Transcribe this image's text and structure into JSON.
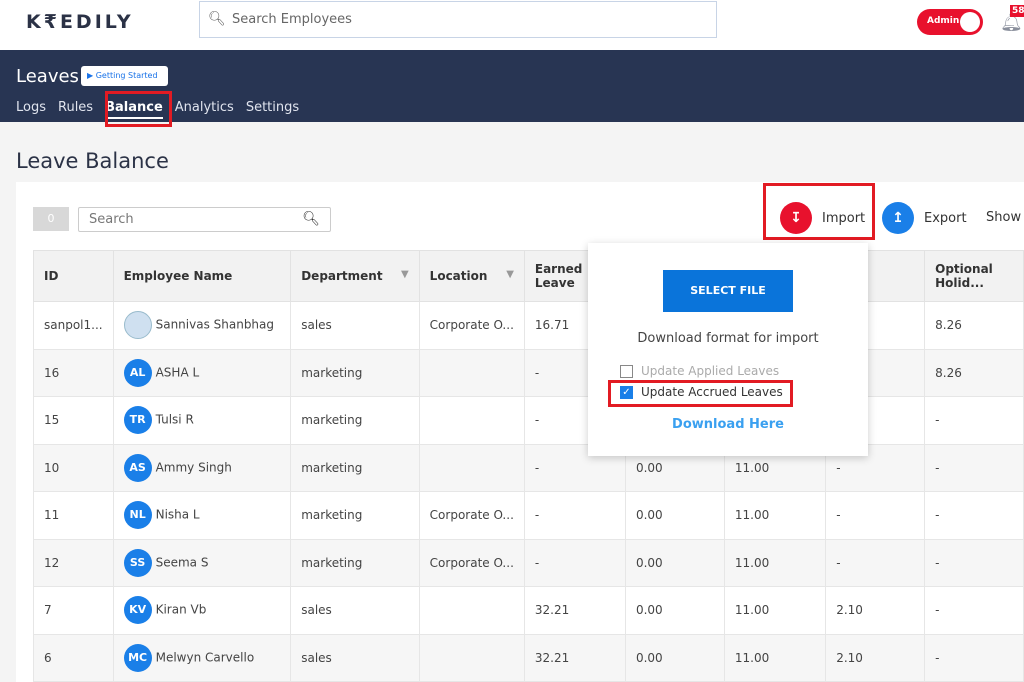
{
  "header": {
    "logo": "K₹EDILY",
    "search_placeholder": "Search Employees",
    "admin_label": "Admin",
    "notification_count": "58"
  },
  "module": {
    "title": "Leaves",
    "getting_started": "Getting Started",
    "tabs": [
      "Logs",
      "Rules",
      "Balance",
      "Analytics",
      "Settings"
    ],
    "active_tab": "Balance"
  },
  "page": {
    "title": "Leave Balance",
    "selected_count": "0",
    "search_placeholder": "Search",
    "import_label": "Import",
    "export_label": "Export",
    "show_label": "Show"
  },
  "table": {
    "headers": [
      "ID",
      "Employee Name",
      "Department",
      "Location",
      "Earned Leave",
      "",
      "",
      "",
      "Optional Holid..."
    ],
    "rows": [
      {
        "id": "sanpol1...",
        "name": "Sannivas Shanbhag",
        "initials": "",
        "department": "sales",
        "location": "Corporate O...",
        "c5": "16.71",
        "c6": "",
        "c7": "",
        "c8": "",
        "c9": "8.26"
      },
      {
        "id": "16",
        "name": "ASHA L",
        "initials": "AL",
        "department": "marketing",
        "location": "",
        "c5": "-",
        "c6": "",
        "c7": "",
        "c8": "",
        "c9": "8.26"
      },
      {
        "id": "15",
        "name": "Tulsi R",
        "initials": "TR",
        "department": "marketing",
        "location": "",
        "c5": "-",
        "c6": "",
        "c7": "",
        "c8": "",
        "c9": "-"
      },
      {
        "id": "10",
        "name": "Ammy Singh",
        "initials": "AS",
        "department": "marketing",
        "location": "",
        "c5": "-",
        "c6": "0.00",
        "c7": "11.00",
        "c8": "-",
        "c9": "-"
      },
      {
        "id": "11",
        "name": "Nisha L",
        "initials": "NL",
        "department": "marketing",
        "location": "Corporate O...",
        "c5": "-",
        "c6": "0.00",
        "c7": "11.00",
        "c8": "-",
        "c9": "-"
      },
      {
        "id": "12",
        "name": "Seema S",
        "initials": "SS",
        "department": "marketing",
        "location": "Corporate O...",
        "c5": "-",
        "c6": "0.00",
        "c7": "11.00",
        "c8": "-",
        "c9": "-"
      },
      {
        "id": "7",
        "name": "Kiran Vb",
        "initials": "KV",
        "department": "sales",
        "location": "",
        "c5": "32.21",
        "c6": "0.00",
        "c7": "11.00",
        "c8": "2.10",
        "c9": "-"
      },
      {
        "id": "6",
        "name": "Melwyn Carvello",
        "initials": "MC",
        "department": "sales",
        "location": "",
        "c5": "32.21",
        "c6": "0.00",
        "c7": "11.00",
        "c8": "2.10",
        "c9": "-"
      }
    ]
  },
  "import_popup": {
    "select_file": "SELECT FILE",
    "download_format": "Download format for import",
    "options": [
      {
        "label": "Update Applied Leaves",
        "checked": false
      },
      {
        "label": "Update Accrued Leaves",
        "checked": true
      }
    ],
    "download_link": "Download Here"
  },
  "colors": {
    "brand_navy": "#283553",
    "accent_red": "#e8112d",
    "primary_blue": "#0a74da",
    "highlight_red": "#e21b23"
  }
}
